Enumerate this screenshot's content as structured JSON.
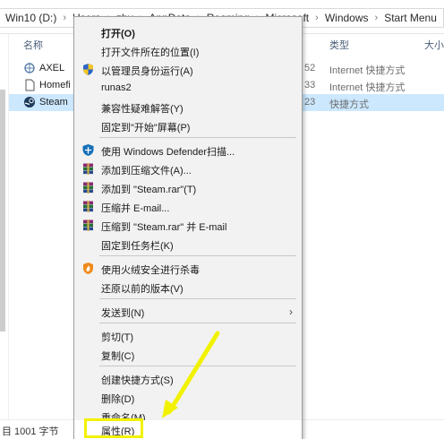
{
  "address": {
    "crumbs": [
      "Win10 (D:)",
      "Users",
      "zhy",
      "AppData",
      "Roaming",
      "Microsoft",
      "Windows",
      "Start Menu"
    ]
  },
  "columns": {
    "name": "名称",
    "type": "类型",
    "size": "大小"
  },
  "files": [
    {
      "name": "AXEL",
      "date_tail": "52",
      "type": "Internet 快捷方式"
    },
    {
      "name": "Homefi",
      "date_tail": "33",
      "type": "Internet 快捷方式"
    },
    {
      "name": "Steam",
      "date_tail": "23",
      "type": "快捷方式"
    }
  ],
  "status": {
    "count_tail": "目",
    "size": "1001 字节"
  },
  "menu": {
    "open": "打开(O)",
    "open_location": "打开文件所在的位置(I)",
    "run_as_admin": "以管理员身份运行(A)",
    "runas2": "runas2",
    "troubleshoot": "兼容性疑难解答(Y)",
    "pin_start": "固定到\"开始\"屏幕(P)",
    "defender": "使用 Windows Defender扫描...",
    "add_archive": "添加到压缩文件(A)...",
    "add_rar": "添加到 \"Steam.rar\"(T)",
    "compress_email": "压缩并 E-mail...",
    "compress_rar_email": "压缩到 \"Steam.rar\" 并 E-mail",
    "pin_taskbar": "固定到任务栏(K)",
    "huorong": "使用火绒安全进行杀毒",
    "restore": "还原以前的版本(V)",
    "send_to": "发送到(N)",
    "cut": "剪切(T)",
    "copy": "复制(C)",
    "create_shortcut": "创建快捷方式(S)",
    "delete": "删除(D)",
    "rename": "重命名(M)",
    "properties": "属性(R)"
  },
  "colors": {
    "selection": "#cce8ff",
    "menu_bg": "#f2f2f2",
    "annotation": "#f2f200"
  }
}
